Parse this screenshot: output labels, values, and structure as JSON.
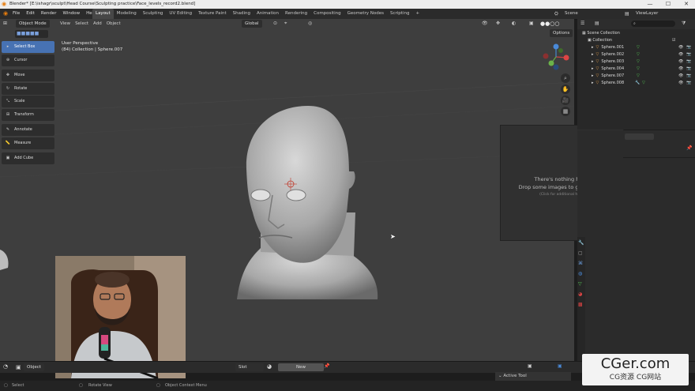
{
  "window": {
    "title": "Blender* [E:\\ishagr\\sculpt\\Head Course\\Sculpting practice\\Face_levels_record2.blend]",
    "minimize": "—",
    "maximize": "☐",
    "close": "✕"
  },
  "menu": [
    "File",
    "Edit",
    "Render",
    "Window",
    "Help"
  ],
  "workspaces": [
    {
      "label": "Layout",
      "active": true
    },
    {
      "label": "Modeling"
    },
    {
      "label": "Sculpting"
    },
    {
      "label": "UV Editing"
    },
    {
      "label": "Texture Paint"
    },
    {
      "label": "Shading"
    },
    {
      "label": "Animation"
    },
    {
      "label": "Rendering"
    },
    {
      "label": "Compositing"
    },
    {
      "label": "Geometry Nodes"
    },
    {
      "label": "Scripting"
    },
    {
      "label": "+"
    }
  ],
  "scene": {
    "label": "Scene",
    "view_layer": "ViewLayer"
  },
  "viewport_header": {
    "mode": "Object Mode",
    "menus": [
      "View",
      "Select",
      "Add",
      "Object"
    ],
    "orientation": "Global",
    "options": "Options"
  },
  "viewport_info": {
    "line1": "User Perspective",
    "line2": "(84) Collection | Sphere.007"
  },
  "tools": [
    {
      "label": "Select Box",
      "icon": "▸",
      "selected": true
    },
    {
      "label": "Cursor",
      "icon": "⊕"
    },
    {
      "label": "Move",
      "icon": "✥"
    },
    {
      "label": "Rotate",
      "icon": "↻"
    },
    {
      "label": "Scale",
      "icon": "⤡"
    },
    {
      "label": "Transform",
      "icon": "⊞"
    },
    {
      "label": "Annotate",
      "icon": "✎"
    },
    {
      "label": "Measure",
      "icon": "📏"
    },
    {
      "label": "Add Cube",
      "icon": "▣"
    }
  ],
  "image_panel": {
    "line1": "There's nothing here!",
    "line2": "Drop some images to get started.",
    "hint": "(Click for additional help)"
  },
  "outliner": {
    "title": "Scene Collection",
    "collection": "Collection",
    "items": [
      "Sphere.001",
      "Sphere.002",
      "Sphere.003",
      "Sphere.004",
      "Sphere.007",
      "Sphere.008"
    ]
  },
  "bottom_header": {
    "mode": "Object",
    "slot": "Slot",
    "new": "New"
  },
  "active_tool": "Active Tool",
  "status_bar": {
    "select": "Select",
    "rotate": "Rotate View",
    "context": "Object Context Menu"
  },
  "watermark": {
    "brand": "CGer.com",
    "sub": "CG资源 CG网站"
  },
  "colors": {
    "accent": "#4772b3",
    "viewport": "#3e3e3e",
    "panel": "#2b2b2b"
  }
}
